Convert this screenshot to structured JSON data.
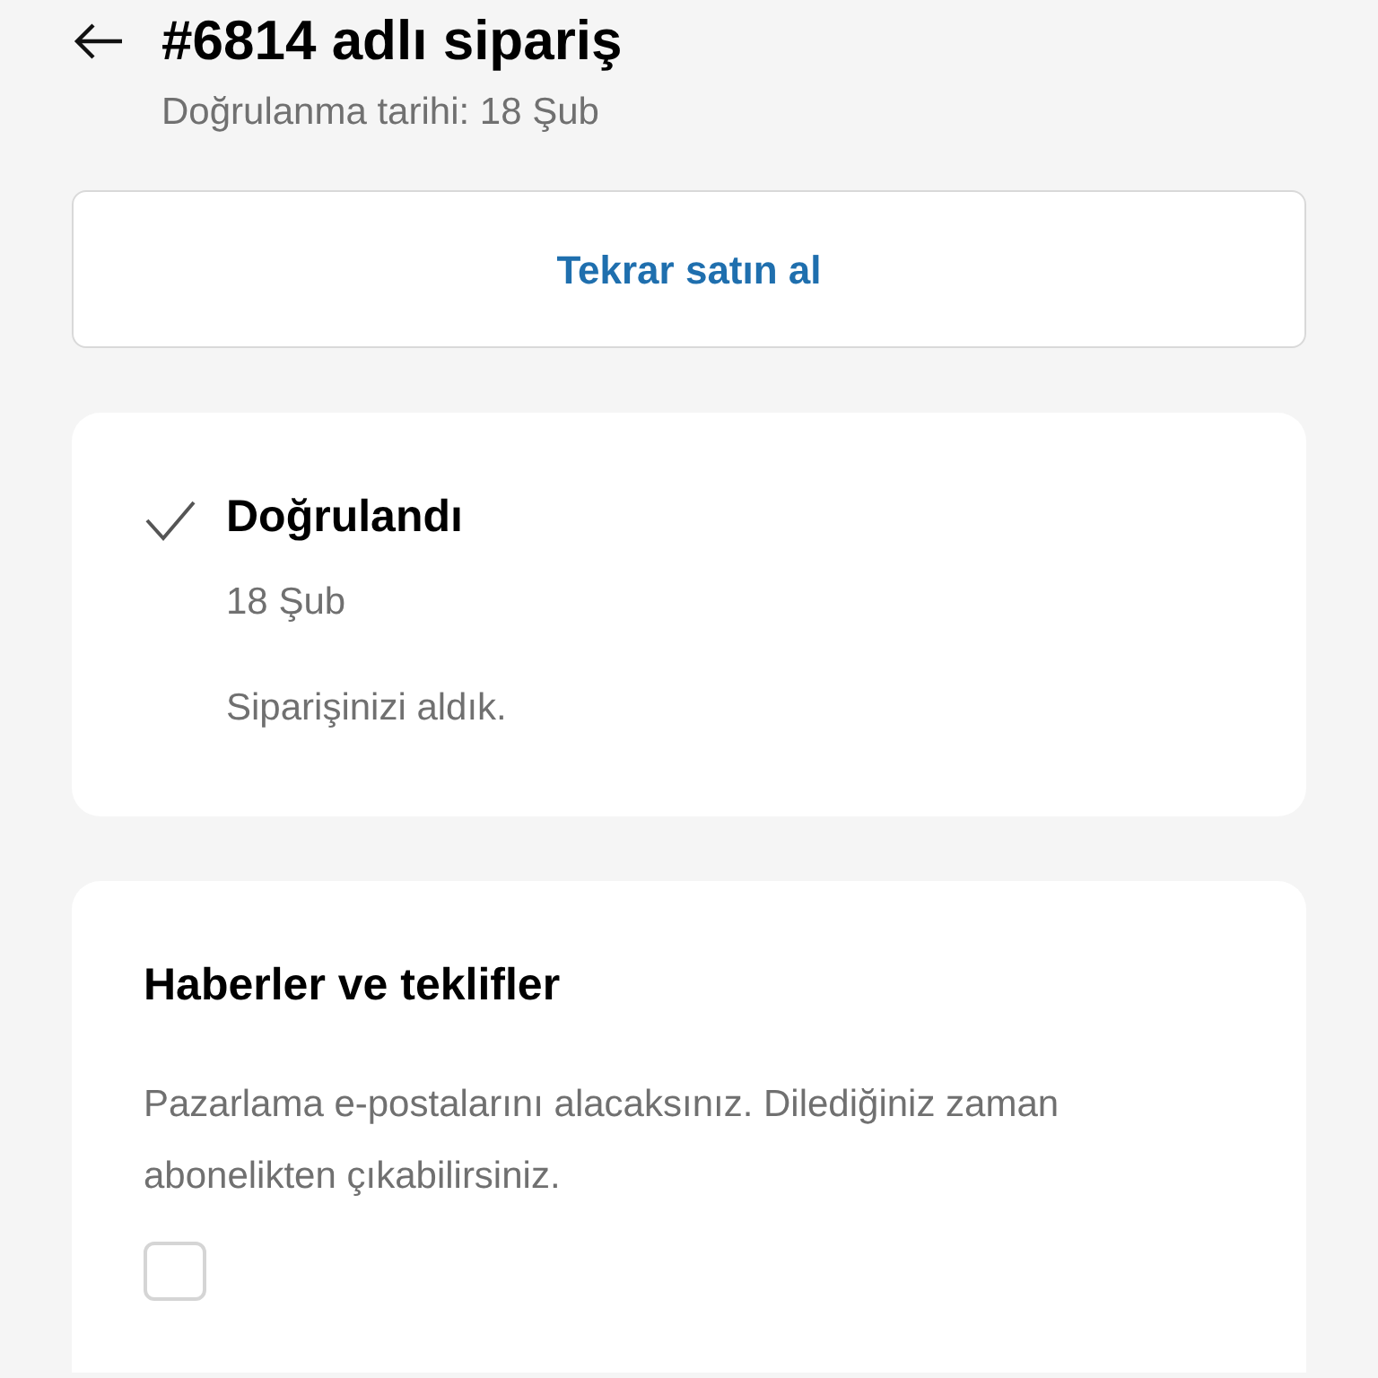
{
  "header": {
    "title": "#6814 adlı sipariş",
    "subtitle": "Doğrulanma tarihi: 18 Şub"
  },
  "reorder_button": {
    "label": "Tekrar satın al"
  },
  "status": {
    "checked": true,
    "title": "Doğrulandı",
    "date": "18 Şub",
    "message": "Siparişinizi aldık."
  },
  "news": {
    "title": "Haberler ve teklifler",
    "description": "Pazarlama e-postalarını alacaksınız. Dilediğiniz zaman abonelikten çıkabilirsiniz.",
    "checked": false
  }
}
